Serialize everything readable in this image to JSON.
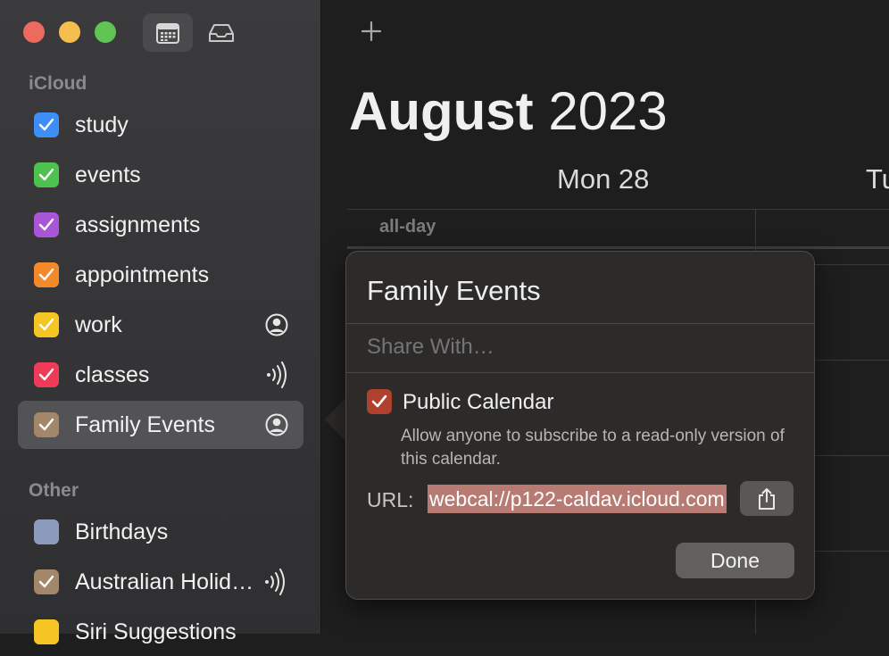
{
  "sidebar": {
    "sections": [
      {
        "label": "iCloud"
      },
      {
        "label": "Other"
      }
    ],
    "calendars": [
      {
        "name": "study",
        "color": "#3d8ff7",
        "checked": true
      },
      {
        "name": "events",
        "color": "#4fc14f",
        "checked": true
      },
      {
        "name": "assignments",
        "color": "#a855d8",
        "checked": true
      },
      {
        "name": "appointments",
        "color": "#f28a2c",
        "checked": true
      },
      {
        "name": "work",
        "color": "#f5c524",
        "checked": true,
        "trailing_icon": "shared-person-icon"
      },
      {
        "name": "classes",
        "color": "#ef3b59",
        "checked": true,
        "trailing_icon": "broadcast-icon"
      },
      {
        "name": "Family Events",
        "color": "#a3876a",
        "checked": true,
        "trailing_icon": "shared-person-icon",
        "selected": true
      }
    ],
    "other_calendars": [
      {
        "name": "Birthdays",
        "color": "#8c9bbd",
        "checked": false
      },
      {
        "name": "Australian Holid…",
        "color": "#a3876a",
        "checked": true,
        "trailing_icon": "broadcast-icon"
      },
      {
        "name": "Siri Suggestions",
        "color": "#f5c524",
        "checked": true
      }
    ]
  },
  "main": {
    "month": "August",
    "year": "2023",
    "days": [
      "Mon 28",
      "Tu"
    ],
    "allday_label": "all-day"
  },
  "popover": {
    "title": "Family Events",
    "share_placeholder": "Share With…",
    "public_label": "Public Calendar",
    "public_checked": true,
    "public_description": "Allow anyone to subscribe to a read-only version of this calendar.",
    "url_label": "URL:",
    "url_value": "webcal://p122-caldav.icloud.com",
    "done_label": "Done"
  }
}
